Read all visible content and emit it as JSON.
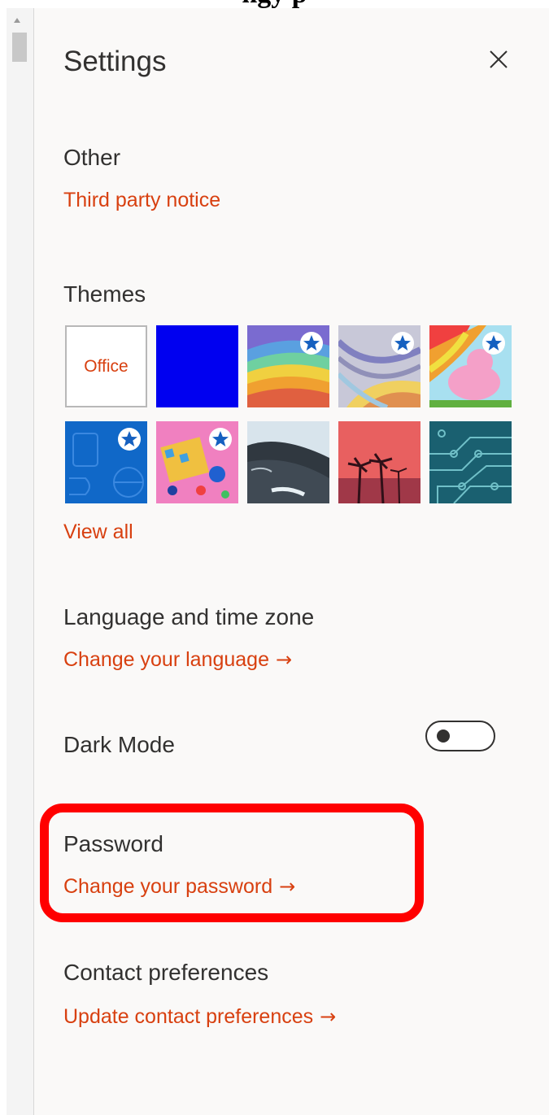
{
  "settings": {
    "title": "Settings",
    "close_icon": "close-icon",
    "other": {
      "heading": "Other",
      "link": "Third party notice"
    },
    "themes": {
      "heading": "Themes",
      "office_label": "Office",
      "view_all": "View all"
    },
    "language": {
      "heading": "Language and time zone",
      "link": "Change your language",
      "arrow": "→"
    },
    "dark_mode": {
      "heading": "Dark Mode",
      "enabled": false
    },
    "password": {
      "heading": "Password",
      "link": "Change your password",
      "arrow": "→"
    },
    "contact": {
      "heading": "Contact preferences",
      "link": "Update contact preferences",
      "arrow": "→"
    }
  },
  "colors": {
    "accent": "#d84010",
    "panel_bg": "#faf9f8",
    "text": "#323130",
    "highlight": "#ff0000"
  }
}
